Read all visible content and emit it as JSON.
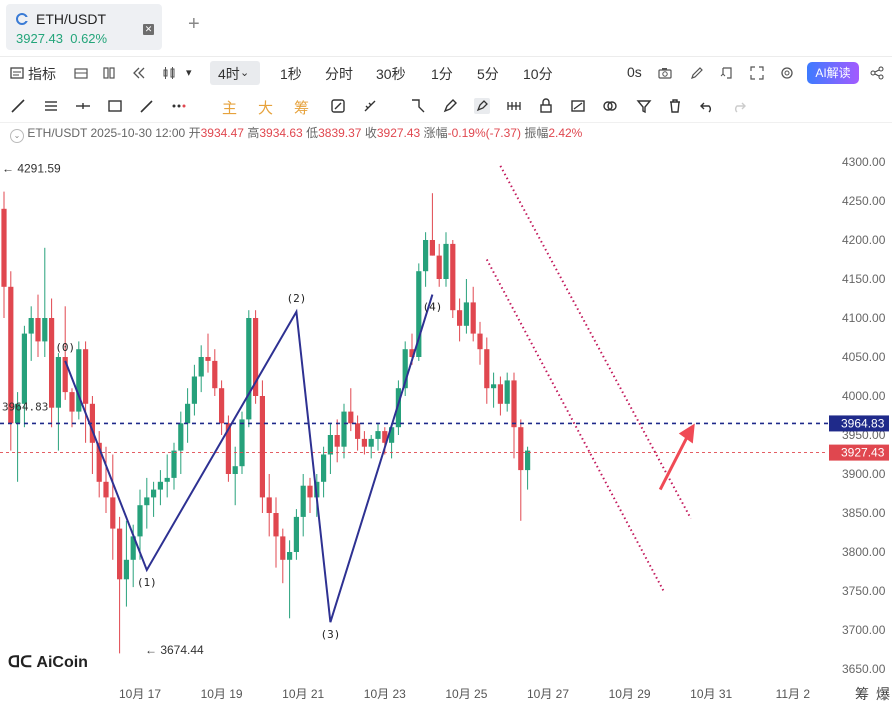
{
  "tab": {
    "title": "ETH/USDT",
    "price": "3927.43",
    "change": "0.62%",
    "close_icon": "x",
    "add_icon": "plus"
  },
  "toolbar": {
    "indicators_label": "指标",
    "intervals": [
      "4时",
      "1秒",
      "分时",
      "30秒",
      "1分",
      "5分",
      "10分"
    ],
    "active_interval": "4时",
    "replay_label": "0s",
    "ai_label": "AI解读",
    "icons": [
      "indicator-icon",
      "layout-icon",
      "template-icon",
      "replay-icon",
      "candle-type-icon",
      "chevron-down-icon",
      "camera-icon",
      "edit-icon",
      "save-icon",
      "fullscreen-icon",
      "settings-icon",
      "share-icon"
    ]
  },
  "drawbar": {
    "text_tools": [
      "主",
      "大",
      "筹"
    ],
    "icons": [
      "line-tool-icon",
      "hline-tool-icon",
      "ray-tool-icon",
      "rect-tool-icon",
      "brush-tool-icon",
      "more-icon",
      "magnet-icon",
      "measure-icon",
      "ruler-icon",
      "pen-icon",
      "wave-icon",
      "lock-icon",
      "hide-icon",
      "link-icon",
      "filter-icon",
      "trash-icon",
      "undo-icon",
      "redo-icon"
    ]
  },
  "info": {
    "symbol": "ETH/USDT",
    "datetime": "2025-10-30 12:00",
    "open_label": "开",
    "open": "3934.47",
    "high_label": "高",
    "high": "3934.63",
    "low_label": "低",
    "low": "3839.37",
    "close_label": "收",
    "close": "3927.43",
    "change_label": "涨幅",
    "change": "-0.19%(-7.37)",
    "amp_label": "振幅",
    "amp": "2.42%"
  },
  "colors": {
    "up": "#26a17b",
    "down": "#e0474f",
    "wave": "#2e3192",
    "channel": "#c2185b",
    "arrow": "#f04a55"
  },
  "corner_labels": [
    "筹",
    "爆"
  ],
  "chart_data": {
    "type": "candlestick",
    "timeframe": "4h",
    "ylim": [
      3640,
      4310
    ],
    "y_ticks": [
      "4300.00",
      "4250.00",
      "4200.00",
      "4150.00",
      "4100.00",
      "4050.00",
      "4000.00",
      "3950.00",
      "3900.00",
      "3850.00",
      "3800.00",
      "3750.00",
      "3700.00",
      "3650.00"
    ],
    "x_ticks": [
      {
        "label": "10月 17",
        "i": 20
      },
      {
        "label": "10月 19",
        "i": 32
      },
      {
        "label": "10月 21",
        "i": 44
      },
      {
        "label": "10月 23",
        "i": 56
      },
      {
        "label": "10月 25",
        "i": 68
      },
      {
        "label": "10月 27",
        "i": 80
      },
      {
        "label": "10月 29",
        "i": 92
      },
      {
        "label": "10月 31",
        "i": 104
      },
      {
        "label": "11月 2",
        "i": 116
      }
    ],
    "candles": [
      [
        4240,
        4262,
        4100,
        4140
      ],
      [
        4140,
        4160,
        3930,
        3965
      ],
      [
        3965,
        4005,
        3890,
        3990
      ],
      [
        3990,
        4090,
        3960,
        4080
      ],
      [
        4080,
        4115,
        4045,
        4100
      ],
      [
        4100,
        4130,
        4050,
        4070
      ],
      [
        4070,
        4190,
        4050,
        4100
      ],
      [
        4100,
        4125,
        3960,
        3985
      ],
      [
        3985,
        4055,
        3930,
        4050
      ],
      [
        4050,
        4115,
        3995,
        4005
      ],
      [
        4005,
        4010,
        3960,
        3980
      ],
      [
        3980,
        4070,
        3970,
        4060
      ],
      [
        4060,
        4070,
        3940,
        3990
      ],
      [
        3990,
        4000,
        3900,
        3940
      ],
      [
        3940,
        3955,
        3870,
        3890
      ],
      [
        3890,
        3935,
        3850,
        3870
      ],
      [
        3870,
        3925,
        3790,
        3830
      ],
      [
        3830,
        3845,
        3670,
        3765
      ],
      [
        3765,
        3840,
        3730,
        3790
      ],
      [
        3790,
        3835,
        3755,
        3820
      ],
      [
        3820,
        3880,
        3790,
        3860
      ],
      [
        3860,
        3895,
        3830,
        3870
      ],
      [
        3870,
        3890,
        3845,
        3880
      ],
      [
        3880,
        3905,
        3860,
        3890
      ],
      [
        3890,
        3925,
        3870,
        3895
      ],
      [
        3895,
        3940,
        3880,
        3930
      ],
      [
        3930,
        3980,
        3900,
        3965
      ],
      [
        3965,
        4010,
        3940,
        3990
      ],
      [
        3990,
        4040,
        3975,
        4025
      ],
      [
        4025,
        4065,
        4005,
        4050
      ],
      [
        4050,
        4080,
        4030,
        4045
      ],
      [
        4045,
        4060,
        4000,
        4010
      ],
      [
        4010,
        4020,
        3950,
        3965
      ],
      [
        3965,
        3975,
        3890,
        3900
      ],
      [
        3900,
        3935,
        3860,
        3910
      ],
      [
        3910,
        3980,
        3900,
        3970
      ],
      [
        3970,
        4110,
        3960,
        4100
      ],
      [
        4100,
        4110,
        3990,
        4000
      ],
      [
        4000,
        4020,
        3850,
        3870
      ],
      [
        3870,
        3900,
        3820,
        3850
      ],
      [
        3850,
        3870,
        3780,
        3820
      ],
      [
        3820,
        3830,
        3760,
        3790
      ],
      [
        3790,
        3815,
        3715,
        3800
      ],
      [
        3800,
        3855,
        3790,
        3845
      ],
      [
        3845,
        3900,
        3820,
        3885
      ],
      [
        3885,
        3895,
        3850,
        3870
      ],
      [
        3870,
        3900,
        3845,
        3890
      ],
      [
        3890,
        3935,
        3870,
        3925
      ],
      [
        3925,
        3965,
        3900,
        3950
      ],
      [
        3950,
        3970,
        3915,
        3935
      ],
      [
        3935,
        3990,
        3920,
        3980
      ],
      [
        3980,
        4010,
        3955,
        3965
      ],
      [
        3965,
        3975,
        3930,
        3945
      ],
      [
        3945,
        3955,
        3925,
        3935
      ],
      [
        3935,
        3950,
        3920,
        3945
      ],
      [
        3945,
        3965,
        3930,
        3955
      ],
      [
        3955,
        3960,
        3925,
        3940
      ],
      [
        3940,
        3965,
        3920,
        3960
      ],
      [
        3960,
        4020,
        3950,
        4010
      ],
      [
        4010,
        4070,
        4000,
        4060
      ],
      [
        4060,
        4080,
        4040,
        4050
      ],
      [
        4050,
        4170,
        4045,
        4160
      ],
      [
        4160,
        4210,
        4140,
        4200
      ],
      [
        4200,
        4260,
        4180,
        4180
      ],
      [
        4180,
        4195,
        4140,
        4150
      ],
      [
        4150,
        4210,
        4140,
        4195
      ],
      [
        4195,
        4200,
        4100,
        4110
      ],
      [
        4110,
        4125,
        4070,
        4090
      ],
      [
        4090,
        4150,
        4080,
        4120
      ],
      [
        4120,
        4140,
        4070,
        4080
      ],
      [
        4080,
        4095,
        4040,
        4060
      ],
      [
        4060,
        4075,
        3990,
        4010
      ],
      [
        4010,
        4030,
        3985,
        4015
      ],
      [
        4015,
        4025,
        3975,
        3990
      ],
      [
        3990,
        4030,
        3980,
        4020
      ],
      [
        4020,
        4030,
        3920,
        3960
      ],
      [
        3960,
        3970,
        3840,
        3905
      ],
      [
        3905,
        3935,
        3880,
        3930
      ]
    ],
    "annotations": {
      "high_marker": "4291.59",
      "low_marker": "3674.44",
      "left_line_label": "3964.83",
      "dashed_level": 3964.83,
      "current_price": 3927.43,
      "wave_labels": [
        "(0)",
        "(1)",
        "(2)",
        "(3)",
        "(4)"
      ],
      "wave_points": [
        [
          9,
          4045
        ],
        [
          21,
          3777
        ],
        [
          43,
          4108
        ],
        [
          48,
          3710
        ],
        [
          63,
          4130
        ]
      ],
      "channel_upper": [
        [
          73,
          4295
        ],
        [
          101,
          3843
        ]
      ],
      "channel_lower": [
        [
          71,
          4175
        ],
        [
          97,
          3750
        ]
      ]
    }
  }
}
